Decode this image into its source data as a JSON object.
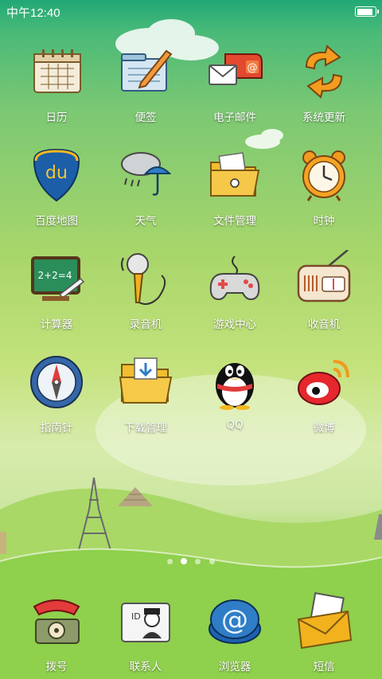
{
  "status_bar": {
    "time": "中午12:40",
    "battery_level": 1.0
  },
  "home_screen": {
    "page_count": 4,
    "current_page": 2,
    "apps": [
      {
        "label": "日历",
        "icon": "calendar-icon"
      },
      {
        "label": "便签",
        "icon": "notes-icon"
      },
      {
        "label": "电子邮件",
        "icon": "mailbox-icon"
      },
      {
        "label": "系统更新",
        "icon": "update-arrows-icon"
      },
      {
        "label": "百度地图",
        "icon": "baidu-map-icon"
      },
      {
        "label": "天气",
        "icon": "weather-umbrella-icon"
      },
      {
        "label": "文件管理",
        "icon": "folder-icon"
      },
      {
        "label": "时钟",
        "icon": "alarm-clock-icon"
      },
      {
        "label": "计算器",
        "icon": "chalkboard-icon"
      },
      {
        "label": "录音机",
        "icon": "microphone-icon"
      },
      {
        "label": "游戏中心",
        "icon": "gamepad-icon"
      },
      {
        "label": "收音机",
        "icon": "radio-icon"
      },
      {
        "label": "指南针",
        "icon": "compass-icon"
      },
      {
        "label": "下载管理",
        "icon": "download-folder-icon"
      },
      {
        "label": "QQ",
        "icon": "qq-penguin-icon"
      },
      {
        "label": "微博",
        "icon": "weibo-icon"
      }
    ]
  },
  "dock": [
    {
      "label": "拨号",
      "icon": "phone-icon"
    },
    {
      "label": "联系人",
      "icon": "contacts-card-icon"
    },
    {
      "label": "浏览器",
      "icon": "browser-at-icon"
    },
    {
      "label": "短信",
      "icon": "message-envelope-icon"
    }
  ],
  "colors": {
    "status_green": "#21a876",
    "grass": "#86cc45",
    "label": "#ffffff"
  }
}
